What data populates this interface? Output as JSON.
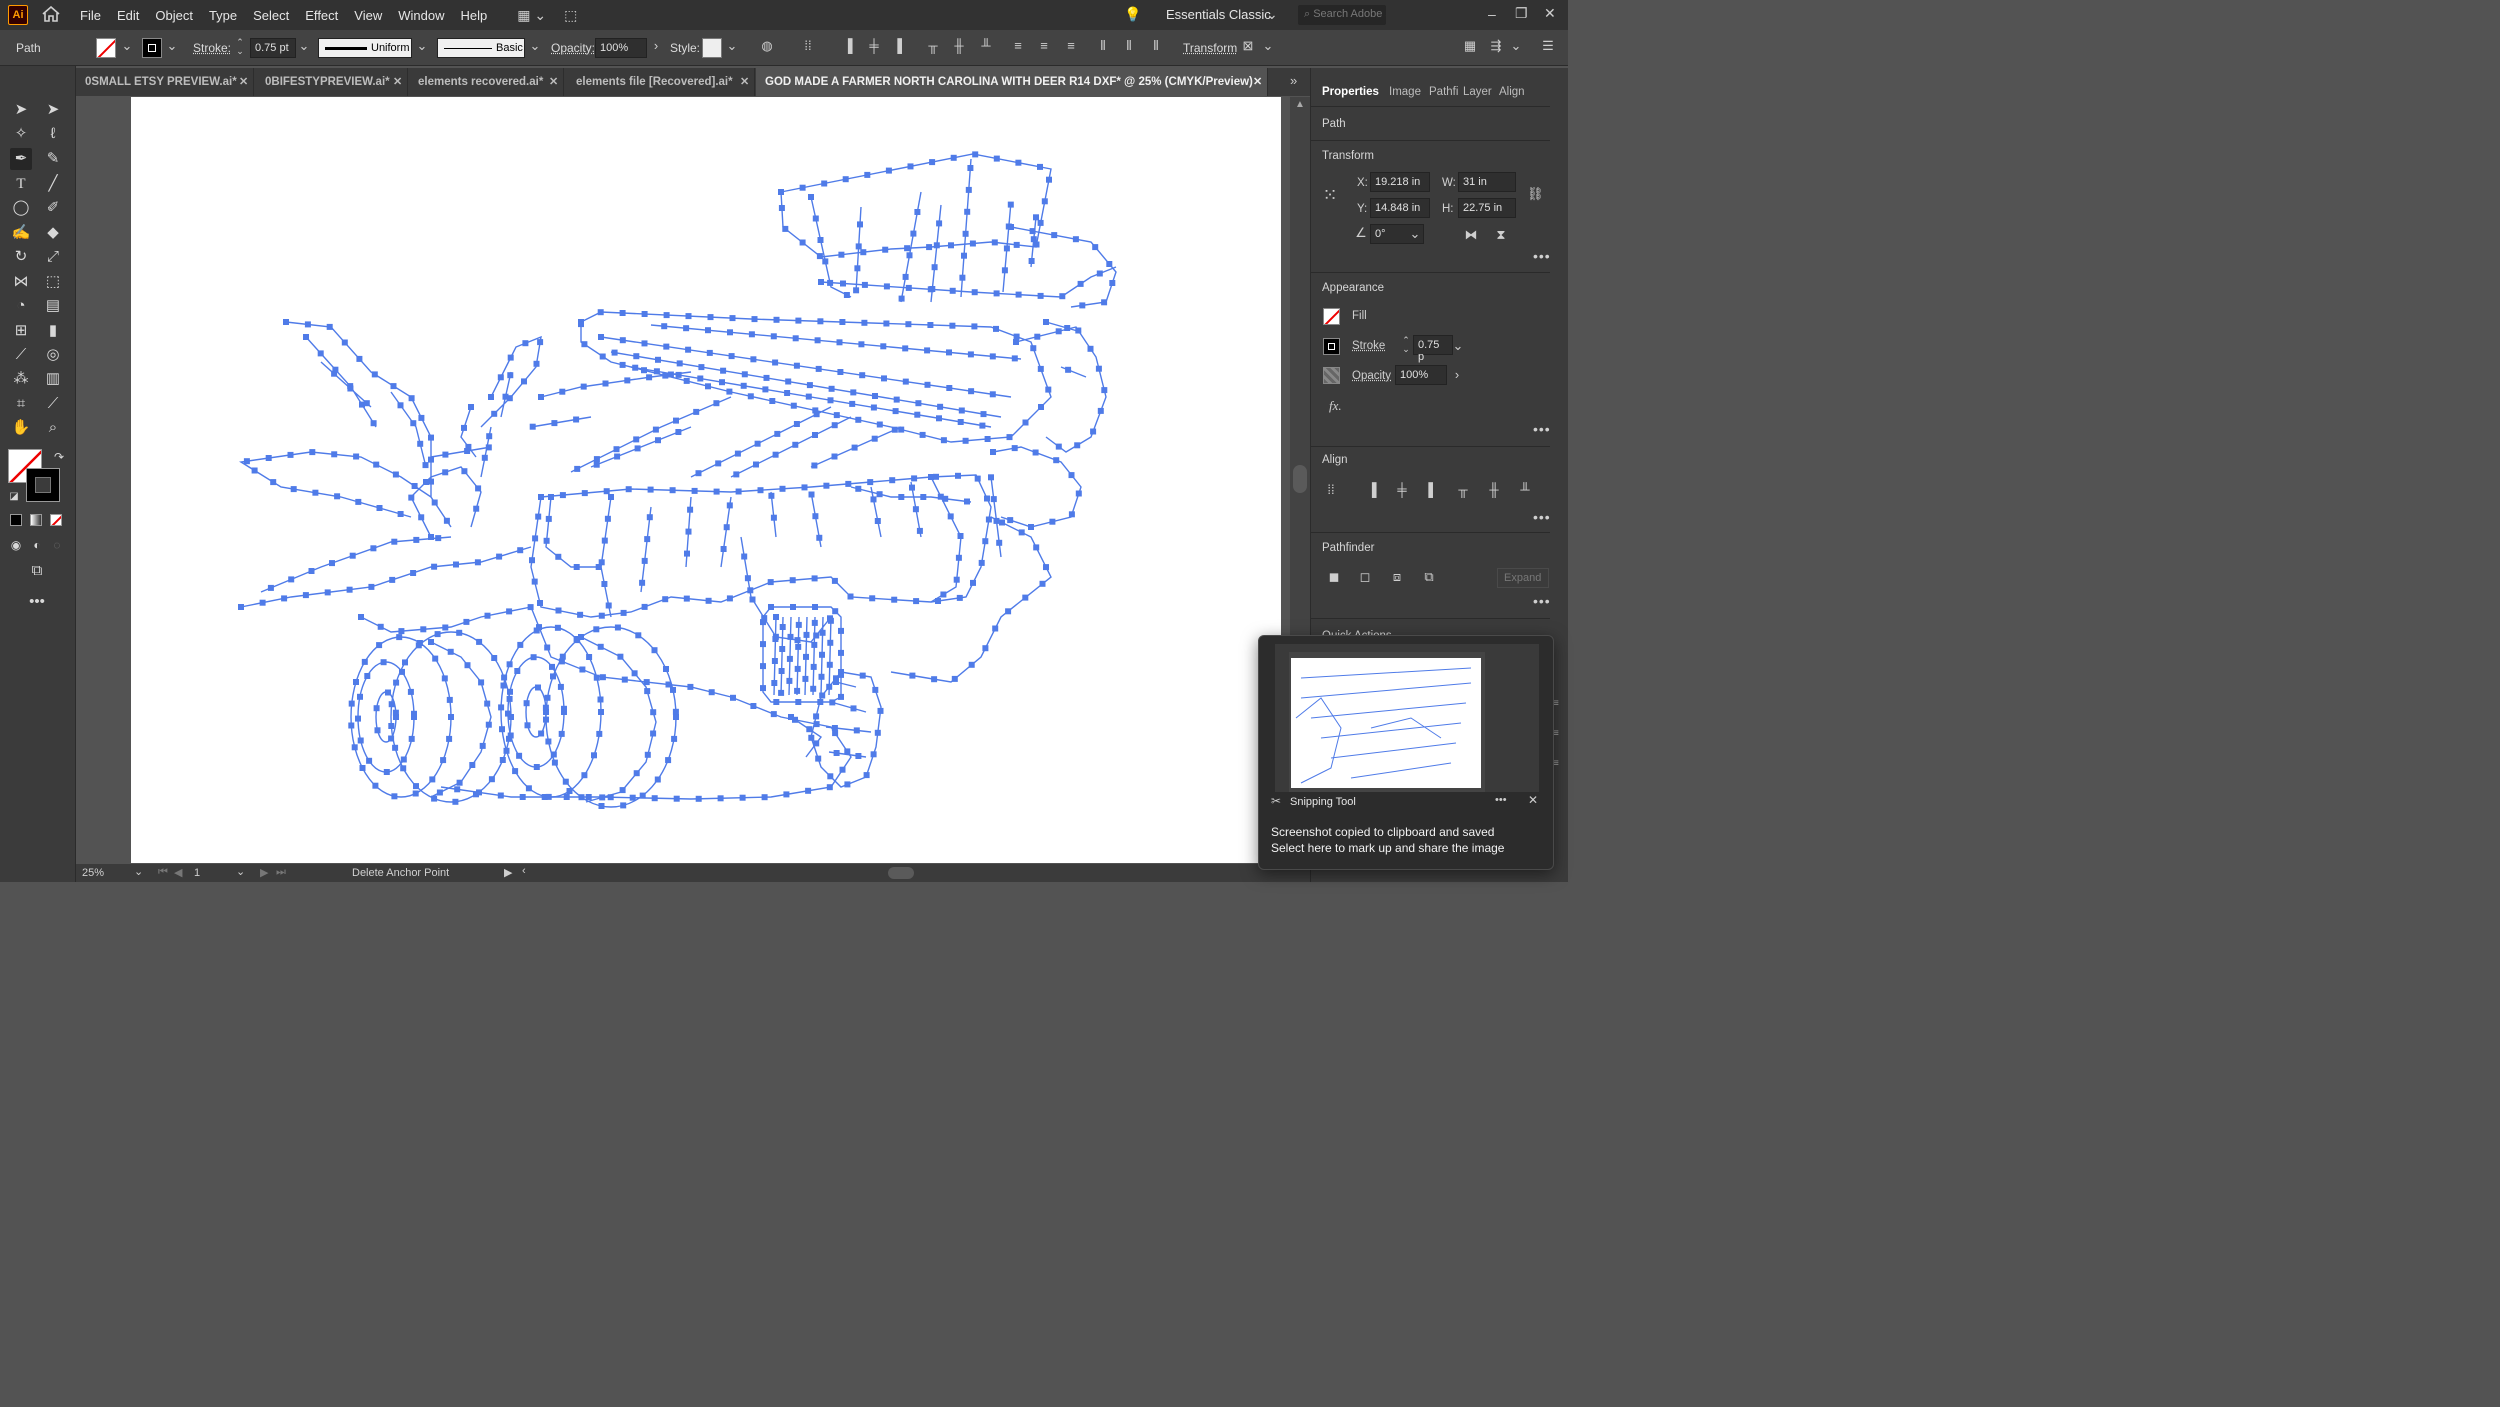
{
  "app": {
    "logo": "Ai",
    "menus": [
      "File",
      "Edit",
      "Object",
      "Type",
      "Select",
      "Effect",
      "View",
      "Window",
      "Help"
    ],
    "workspace": "Essentials Classic",
    "search_placeholder": "Search Adobe Stock"
  },
  "control": {
    "selection_type": "Path",
    "stroke_label": "Stroke:",
    "stroke_weight": "0.75 pt",
    "profile": "Uniform",
    "brush": "Basic",
    "opacity_label": "Opacity:",
    "opacity": "100%",
    "style_label": "Style:",
    "transform_label": "Transform"
  },
  "tabs": [
    {
      "label": "0SMALL ETSY PREVIEW.ai*",
      "active": false
    },
    {
      "label": "0BIFESTYPREVIEW.ai*",
      "active": false
    },
    {
      "label": "elements recovered.ai*",
      "active": false
    },
    {
      "label": "elements file [Recovered].ai*",
      "active": false
    },
    {
      "label": "GOD MADE A FARMER NORTH CAROLINA WITH DEER R14 DXF* @ 25% (CMYK/Preview)",
      "active": true
    }
  ],
  "panel": {
    "tabs": [
      "Properties",
      "Image",
      "Pathfi",
      "Layer",
      "Align"
    ],
    "section_path": "Path",
    "transform": {
      "title": "Transform",
      "x_label": "X:",
      "x": "19.218 in",
      "y_label": "Y:",
      "y": "14.848 in",
      "w_label": "W:",
      "w": "31 in",
      "h_label": "H:",
      "h": "22.75 in",
      "angle": "0°"
    },
    "appearance": {
      "title": "Appearance",
      "fill": "Fill",
      "stroke": "Stroke",
      "stroke_weight": "0.75 p",
      "opacity": "Opacity",
      "opacity_value": "100%",
      "fx": "fx."
    },
    "align_title": "Align",
    "pathfinder_title": "Pathfinder",
    "expand_label": "Expand",
    "quick_actions": "Quick Actions"
  },
  "status": {
    "zoom": "25%",
    "artboard": "1",
    "tool_hint": "Delete Anchor Point"
  },
  "toast": {
    "app": "Snipping Tool",
    "line1": "Screenshot copied to clipboard and saved",
    "line2": "Select here to mark up and share the image"
  },
  "colors": {
    "path": "#4f7be8",
    "accent": "#ff9a00"
  }
}
